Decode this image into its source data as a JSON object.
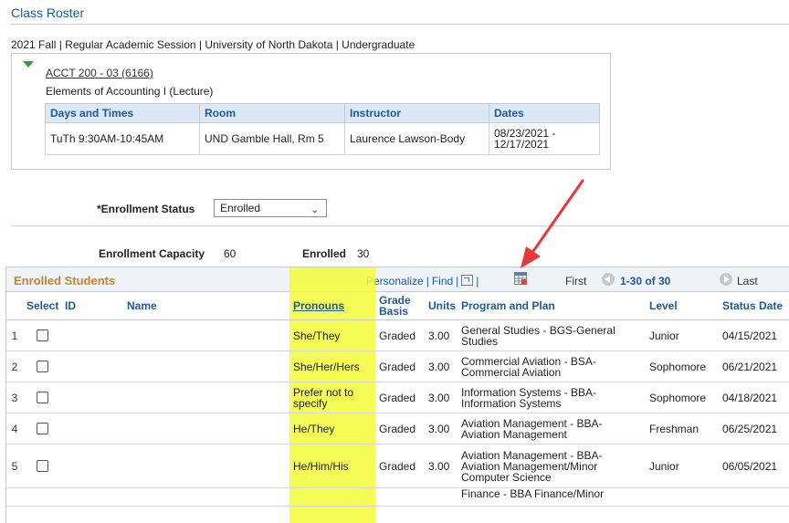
{
  "page": {
    "title": "Class Roster",
    "subtitle": "2021 Fall | Regular Academic Session | University of North Dakota | Undergraduate"
  },
  "class_info": {
    "link": "ACCT 200 - 03 (6166)",
    "description": "Elements of Accounting I (Lecture)",
    "headers": [
      "Days and Times",
      "Room",
      "Instructor",
      "Dates"
    ],
    "days_times": "TuTh 9:30AM-10:45AM",
    "room": "UND Gamble Hall, Rm 5",
    "instructor": "Laurence Lawson-Body",
    "dates_line1": "08/23/2021 -",
    "dates_line2": "12/17/2021"
  },
  "enrollment": {
    "status_label": "*Enrollment Status",
    "status_value": "Enrolled",
    "capacity_label": "Enrollment Capacity",
    "capacity_value": "60",
    "enrolled_label": "Enrolled",
    "enrolled_value": "30"
  },
  "grid": {
    "title": "Enrolled Students",
    "personalize": "Personalize",
    "find": "Find",
    "first": "First",
    "range": "1-30 of 30",
    "last": "Last",
    "columns": {
      "select": "Select",
      "id": "ID",
      "name": "Name",
      "pronouns": "Pronouns",
      "grade_basis_1": "Grade",
      "grade_basis_2": "Basis",
      "units": "Units",
      "program": "Program and Plan",
      "level": "Level",
      "status_date": "Status Date"
    },
    "rows": [
      {
        "num": "1",
        "pron1": "She/They",
        "pron2": "",
        "grade": "Graded",
        "units": "3.00",
        "prog1": "General Studies - BGS-General",
        "prog2": "Studies",
        "prog3": "",
        "level": "Junior",
        "date": "04/15/2021"
      },
      {
        "num": "2",
        "pron1": "She/Her/Hers",
        "pron2": "",
        "grade": "Graded",
        "units": "3.00",
        "prog1": "Commercial Aviation - BSA-",
        "prog2": "Commercial Aviation",
        "prog3": "",
        "level": "Sophomore",
        "date": "06/21/2021"
      },
      {
        "num": "3",
        "pron1": "Prefer not to",
        "pron2": "specify",
        "grade": "Graded",
        "units": "3.00",
        "prog1": "Information Systems - BBA-",
        "prog2": "Information Systems",
        "prog3": "",
        "level": "Sophomore",
        "date": "04/18/2021"
      },
      {
        "num": "4",
        "pron1": "He/They",
        "pron2": "",
        "grade": "Graded",
        "units": "3.00",
        "prog1": "Aviation Management - BBA-",
        "prog2": "Aviation Management",
        "prog3": "",
        "level": "Freshman",
        "date": "06/25/2021"
      },
      {
        "num": "5",
        "pron1": "He/Him/His",
        "pron2": "",
        "grade": "Graded",
        "units": "3.00",
        "prog1": "Aviation Management - BBA-",
        "prog2": "Aviation Management/Minor",
        "prog3": "Computer Science",
        "level": "Junior",
        "date": "06/05/2021"
      },
      {
        "num": "",
        "pron1": "",
        "pron2": "",
        "grade": "",
        "units": "",
        "prog1": "Finance - BBA Finance/Minor",
        "prog2": "",
        "prog3": "",
        "level": "",
        "date": ""
      }
    ]
  },
  "colors": {
    "accent_blue": "#1e5a96",
    "grid_title_orange": "#c7842a",
    "highlight_yellow": "#f3fb37",
    "arrow_red": "#e8383b"
  },
  "icons": [
    "expand-triangle-icon",
    "zoom-icon",
    "download-grid-icon",
    "previous-icon",
    "next-icon",
    "annotation-arrow-icon"
  ]
}
